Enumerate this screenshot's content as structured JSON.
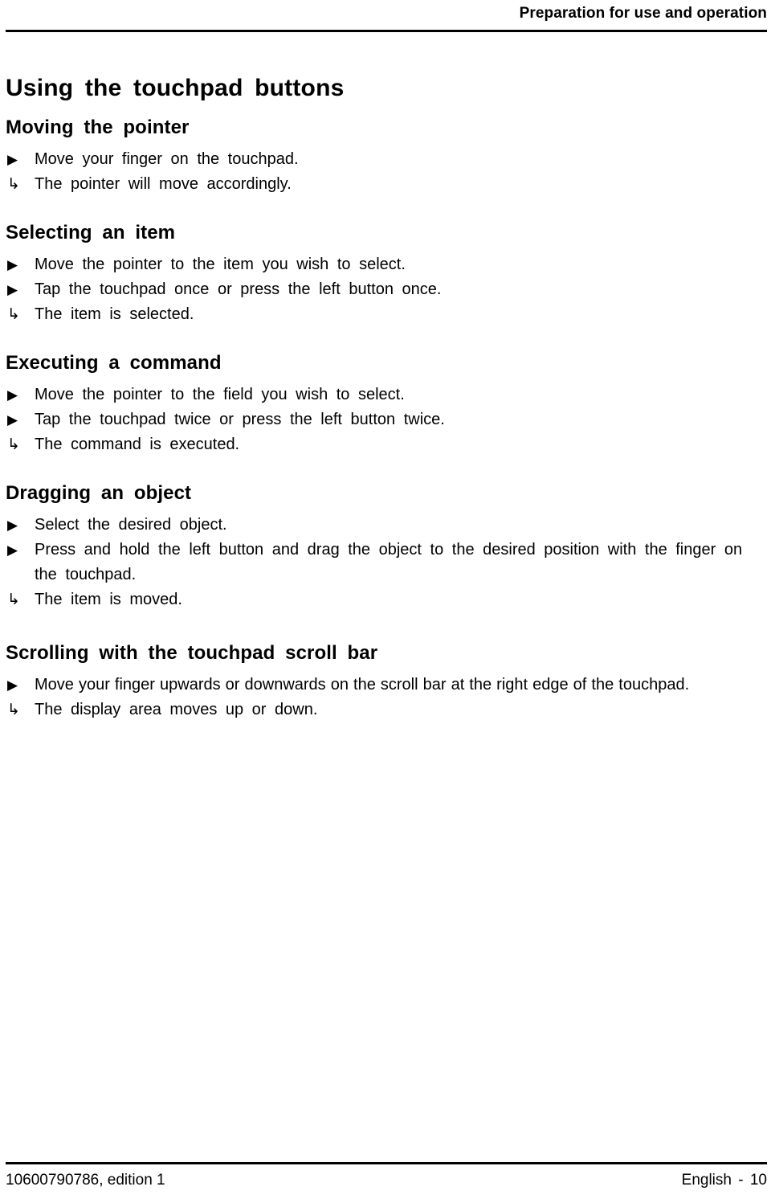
{
  "header": {
    "title": "Preparation for use and operation"
  },
  "document": {
    "title": "Using the touchpad buttons"
  },
  "markers": {
    "action": "▶",
    "result": "↳"
  },
  "sections": [
    {
      "id": "moving-the-pointer",
      "heading": "Moving the pointer",
      "steps": [
        {
          "marker": "action",
          "text": "Move your finger on the touchpad."
        },
        {
          "marker": "result",
          "text": "The pointer will move accordingly."
        }
      ]
    },
    {
      "id": "selecting-an-item",
      "heading": "Selecting an item",
      "steps": [
        {
          "marker": "action",
          "text": "Move the pointer to the item you wish to select."
        },
        {
          "marker": "action",
          "text": "Tap the touchpad once or press the left button once."
        },
        {
          "marker": "result",
          "text": "The item is selected."
        }
      ]
    },
    {
      "id": "executing-a-command",
      "heading": "Executing a command",
      "steps": [
        {
          "marker": "action",
          "text": "Move the pointer to the field you wish to select."
        },
        {
          "marker": "action",
          "text": "Tap the touchpad twice or press the left button twice."
        },
        {
          "marker": "result",
          "text": "The command is executed."
        }
      ]
    },
    {
      "id": "dragging-an-object",
      "heading": "Dragging an object",
      "steps": [
        {
          "marker": "action",
          "text": "Select the desired object."
        },
        {
          "marker": "action",
          "text": "Press and hold the left button and drag the object to the desired position with the finger on the touchpad."
        },
        {
          "marker": "result",
          "text": "The item is moved."
        }
      ]
    },
    {
      "id": "scrolling-with-the-touchpad-scroll-bar",
      "heading": "Scrolling with the touchpad scroll bar",
      "steps": [
        {
          "marker": "action",
          "tight": true,
          "text": "Move your finger upwards or downwards on the scroll bar at the right edge of the touchpad."
        },
        {
          "marker": "result",
          "text": "The display area moves up or down."
        }
      ]
    }
  ],
  "footer": {
    "left": "10600790786, edition 1",
    "right": "English - 10"
  }
}
